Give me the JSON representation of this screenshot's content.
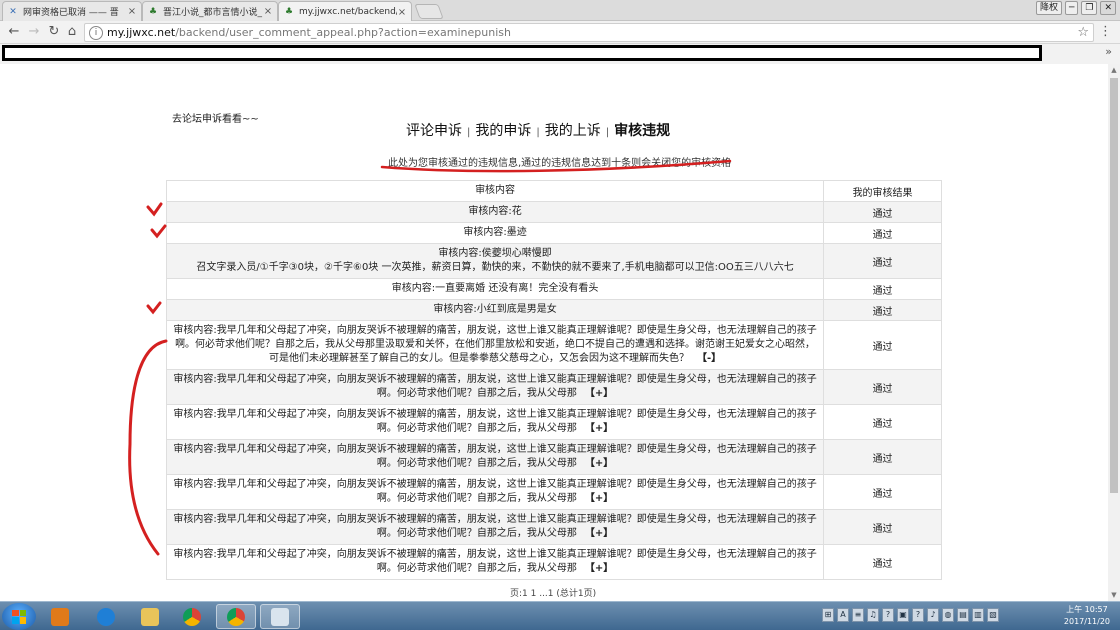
{
  "browser": {
    "tabs": [
      {
        "title": "网审资格已取消 —— 晋",
        "favicon": "jjwxc-icon"
      },
      {
        "title": "晋江小说_都市言情小说_",
        "favicon": "jjwxc-tree-icon"
      },
      {
        "title": "my.jjwxc.net/backend/",
        "favicon": "jjwxc-tree-icon"
      }
    ],
    "window_buttons": [
      "降权",
      "─",
      "❐",
      "✕"
    ],
    "url_host": "my.jjwxc.net",
    "url_path": "/backend/user_comment_appeal.php?action=examinepunish"
  },
  "page": {
    "forum_link": "去论坛申诉看看~~",
    "nav": [
      {
        "label": "评论申诉",
        "current": false
      },
      {
        "label": "我的申诉",
        "current": false
      },
      {
        "label": "我的上诉",
        "current": false
      },
      {
        "label": "审核违规",
        "current": true
      }
    ],
    "nav_separator": "|",
    "notice": "此处为您审核通过的违规信息,通过的违规信息达到十条则会关闭您的审核资格",
    "table": {
      "headers": [
        "审核内容",
        "我的审核结果"
      ],
      "rows": [
        {
          "content": "审核内容:花",
          "result": "通过",
          "toggle": ""
        },
        {
          "content": "审核内容:墨迹",
          "result": "通过",
          "toggle": ""
        },
        {
          "content": "审核内容:侯夔坝心啭慢即\n召文字录入员/①千字③0块，②千字⑥0块 一次英推，薪资日算，勤快的来，不勤快的就不要来了,手机电脑都可以卫信:OO五三八八六七",
          "result": "通过",
          "toggle": ""
        },
        {
          "content": "审核内容:一直要离婚 还没有离！完全没有看头",
          "result": "通过",
          "toggle": ""
        },
        {
          "content": "审核内容:小红到底是男是女",
          "result": "通过",
          "toggle": ""
        },
        {
          "content": "审核内容:我早几年和父母起了冲突，向朋友哭诉不被理解的痛苦，朋友说，这世上谁又能真正理解谁呢？即使是生身父母，也无法理解自己的孩子啊。何必苛求他们呢？自那之后，我从父母那里汲取爱和关怀，在他们那里放松和安逝，绝口不提自己的遭遇和选择。谢范谢王妃爱女之心昭然，可是他们未必理解甚至了解自己的女儿。但是拳拳慈父慈母之心，又怎会因为这不理解而失色？",
          "result": "通过",
          "toggle": "【-】"
        },
        {
          "content": "审核内容:我早几年和父母起了冲突，向朋友哭诉不被理解的痛苦，朋友说，这世上谁又能真正理解谁呢？即使是生身父母，也无法理解自己的孩子啊。何必苛求他们呢？自那之后，我从父母那",
          "result": "通过",
          "toggle": "【+】"
        },
        {
          "content": "审核内容:我早几年和父母起了冲突，向朋友哭诉不被理解的痛苦，朋友说，这世上谁又能真正理解谁呢？即使是生身父母，也无法理解自己的孩子啊。何必苛求他们呢？自那之后，我从父母那",
          "result": "通过",
          "toggle": "【+】"
        },
        {
          "content": "审核内容:我早几年和父母起了冲突，向朋友哭诉不被理解的痛苦，朋友说，这世上谁又能真正理解谁呢？即使是生身父母，也无法理解自己的孩子啊。何必苛求他们呢？自那之后，我从父母那",
          "result": "通过",
          "toggle": "【+】"
        },
        {
          "content": "审核内容:我早几年和父母起了冲突，向朋友哭诉不被理解的痛苦，朋友说，这世上谁又能真正理解谁呢？即使是生身父母，也无法理解自己的孩子啊。何必苛求他们呢？自那之后，我从父母那",
          "result": "通过",
          "toggle": "【+】"
        },
        {
          "content": "审核内容:我早几年和父母起了冲突，向朋友哭诉不被理解的痛苦，朋友说，这世上谁又能真正理解谁呢？即使是生身父母，也无法理解自己的孩子啊。何必苛求他们呢？自那之后，我从父母那",
          "result": "通过",
          "toggle": "【+】"
        },
        {
          "content": "审核内容:我早几年和父母起了冲突，向朋友哭诉不被理解的痛苦，朋友说，这世上谁又能真正理解谁呢？即使是生身父母，也无法理解自己的孩子啊。何必苛求他们呢？自那之后，我从父母那",
          "result": "通过",
          "toggle": "【+】"
        }
      ]
    },
    "pager": "页:1 1 ...1 (总计1页)"
  },
  "taskbar": {
    "items": [
      "windows-media-player-icon",
      "internet-explorer-icon",
      "file-explorer-icon",
      "chrome-icon",
      "chrome-icon",
      "paint-icon"
    ],
    "time": "上午 10:57",
    "date": "2017/11/20"
  },
  "colors": {
    "annotation": "#d42020",
    "table_border": "#dedede",
    "row_shade": "#f3f3f3"
  }
}
